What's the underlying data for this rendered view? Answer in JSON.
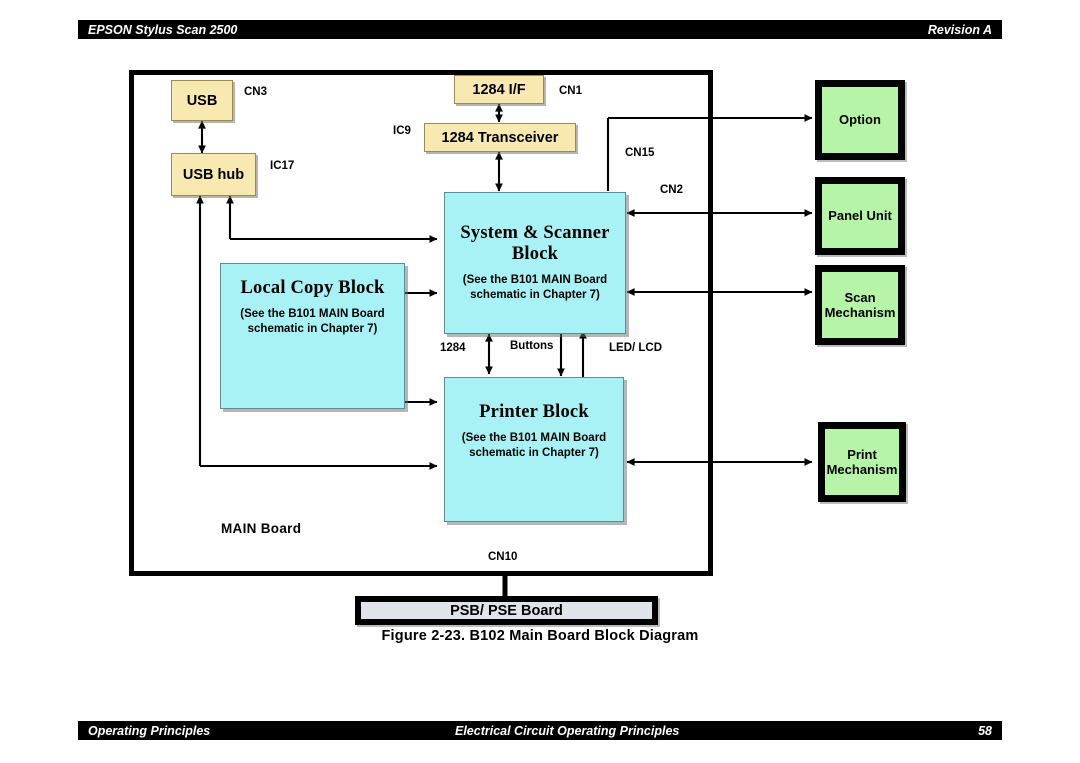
{
  "header": {
    "left": "EPSON Stylus Scan 2500",
    "right": "Revision A"
  },
  "footer": {
    "left": "Operating Principles",
    "center": "Electrical Circuit Operating Principles",
    "page": "58"
  },
  "figure": {
    "caption": "Figure 2-23.  B102 Main Board Block Diagram"
  },
  "diagram": {
    "board_label": "MAIN Board",
    "interface_boxes": [
      {
        "id": "usb",
        "label": "USB"
      },
      {
        "id": "usb-hub",
        "label": "USB hub"
      },
      {
        "id": "1284-if",
        "label": "1284 I/F"
      },
      {
        "id": "1284-transceiver",
        "label": "1284 Transceiver"
      }
    ],
    "function_blocks": [
      {
        "id": "system-scanner-block",
        "title": "System & Scanner Block",
        "sub": "(See the B101 MAIN Board schematic in Chapter 7)"
      },
      {
        "id": "local-copy-block",
        "title": "Local Copy Block",
        "sub": "(See the B101 MAIN Board schematic in Chapter 7)"
      },
      {
        "id": "printer-block",
        "title": "Printer Block",
        "sub": "(See the B101 MAIN Board schematic in Chapter 7)"
      }
    ],
    "peripherals": [
      {
        "id": "option",
        "label": "Option"
      },
      {
        "id": "panel-unit",
        "label": "Panel Unit"
      },
      {
        "id": "scan-mechanism",
        "label": "Scan Mechanism"
      },
      {
        "id": "print-mechanism",
        "label": "Print Mechanism"
      }
    ],
    "power_board": {
      "label": "PSB/ PSE Board"
    },
    "connector_tags": [
      {
        "id": "cn3",
        "text": "CN3"
      },
      {
        "id": "ic17",
        "text": "IC17"
      },
      {
        "id": "cn1",
        "text": "CN1"
      },
      {
        "id": "ic9",
        "text": "IC9"
      },
      {
        "id": "cn15",
        "text": "CN15"
      },
      {
        "id": "cn2",
        "text": "CN2"
      },
      {
        "id": "cn10",
        "text": "CN10"
      }
    ],
    "signal_tags": [
      {
        "id": "sig-1284",
        "text": "1284"
      },
      {
        "id": "sig-buttons",
        "text": "Buttons"
      },
      {
        "id": "sig-ledlcd",
        "text": "LED/ LCD"
      }
    ],
    "colors": {
      "interface_fill": "#f7e9b0",
      "block_fill": "#a8f2f6",
      "peripheral_fill": "#b6f5a8",
      "power_fill": "#dfe4ea",
      "line": "#000000",
      "bar": "#000000"
    }
  }
}
